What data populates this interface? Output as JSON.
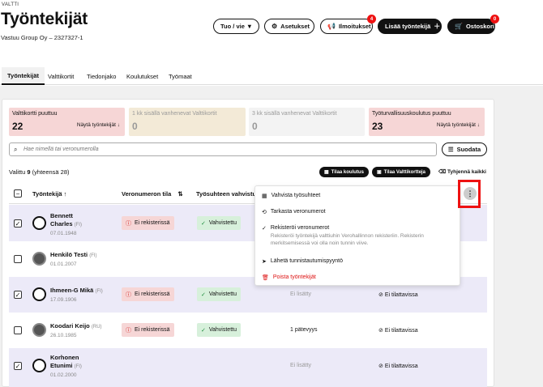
{
  "header": {
    "brand": "VALTTI",
    "title": "Työntekijät",
    "company": "Vastuu Group Oy – 2327327-1"
  },
  "actions": {
    "import_export": "Tuo / vie",
    "settings": "Asetukset",
    "notifications": "Ilmoitukset",
    "notifications_count": "4",
    "add_employee": "Lisää työntekijä",
    "cart": "Ostoskori",
    "cart_count": "0"
  },
  "tabs": [
    "Työntekijät",
    "Valttikortit",
    "Tiedonjako",
    "Koulutukset",
    "Työmaat"
  ],
  "stats": [
    {
      "label": "Valttikortti puuttuu",
      "value": "22",
      "link": "Näytä työntekijät"
    },
    {
      "label": "1 kk sisällä vanhenevat Valttikortit",
      "value": "0"
    },
    {
      "label": "3 kk sisällä vanhenevat Valttikortit",
      "value": "0"
    },
    {
      "label": "Työturvallisuuskoulutus puuttuu",
      "value": "23",
      "link": "Näytä työntekijät"
    }
  ],
  "search": {
    "placeholder": "Hae nimellä tai veronumerolla"
  },
  "filter_label": "Suodata",
  "selection": {
    "prefix": "Valittu",
    "count": "9",
    "total_text": "(yhteensä 28)"
  },
  "bulk": {
    "order_training": "Tilaa koulutus",
    "order_cards": "Tilaa Valttikortteja",
    "clear_all": "Tyhjennä kaikki"
  },
  "columns": {
    "employee": "Työntekijä",
    "tax_status": "Veronumeron tila",
    "employment": "Työsuhteen vahvistus"
  },
  "rows": [
    {
      "name1": "Bennett",
      "name2": "Charles",
      "country": "(FI)",
      "date": "07.01.1948",
      "tax": "Ei rekisterissä",
      "emp": "Vahvistettu",
      "checked": "✓"
    },
    {
      "name1": "Henkilö Testi",
      "country": "(FI)",
      "date": "01.01.2007",
      "checked": ""
    },
    {
      "name1": "Ihmeen-G Mikä",
      "country": "(FI)",
      "date": "17.09.1906",
      "tax": "Ei rekisterissä",
      "emp": "Vahvistettu",
      "extra": "Ei lisätty",
      "order": "Ei tilattavissa",
      "checked": "✓"
    },
    {
      "name1": "Koodari Keijo",
      "country": "(RU)",
      "date": "26.10.1985",
      "tax": "Ei rekisterissä",
      "emp": "Vahvistettu",
      "extra": "1 pätevyys",
      "order": "Ei tilattavissa",
      "checked": ""
    },
    {
      "name1": "Korhonen",
      "name2": "Etunimi",
      "country": "(FI)",
      "date": "01.02.2000",
      "extra": "Ei lisätty",
      "order": "Ei tilattavissa",
      "checked": "✓"
    }
  ],
  "menu": {
    "confirm": "Vahvista työsuhteet",
    "check_tax": "Tarkasta veronumerot",
    "register_tax": "Rekisteröi veronumerot",
    "register_desc": "Rekisteröi työntekijä valttiuhin Verohallinnon rekisteriin. Rekisterin merkitsemisessä voi olla noin tunnin viive.",
    "send_id": "Lähetä tunnistautumispyyntö",
    "delete": "Poista työntekijät"
  },
  "kebab": "⋮",
  "colors": {
    "danger": "#e11d1d",
    "selected_row": "#eceaf8",
    "success_bg": "#d7f0db",
    "error_bg": "#f6d6d6"
  }
}
